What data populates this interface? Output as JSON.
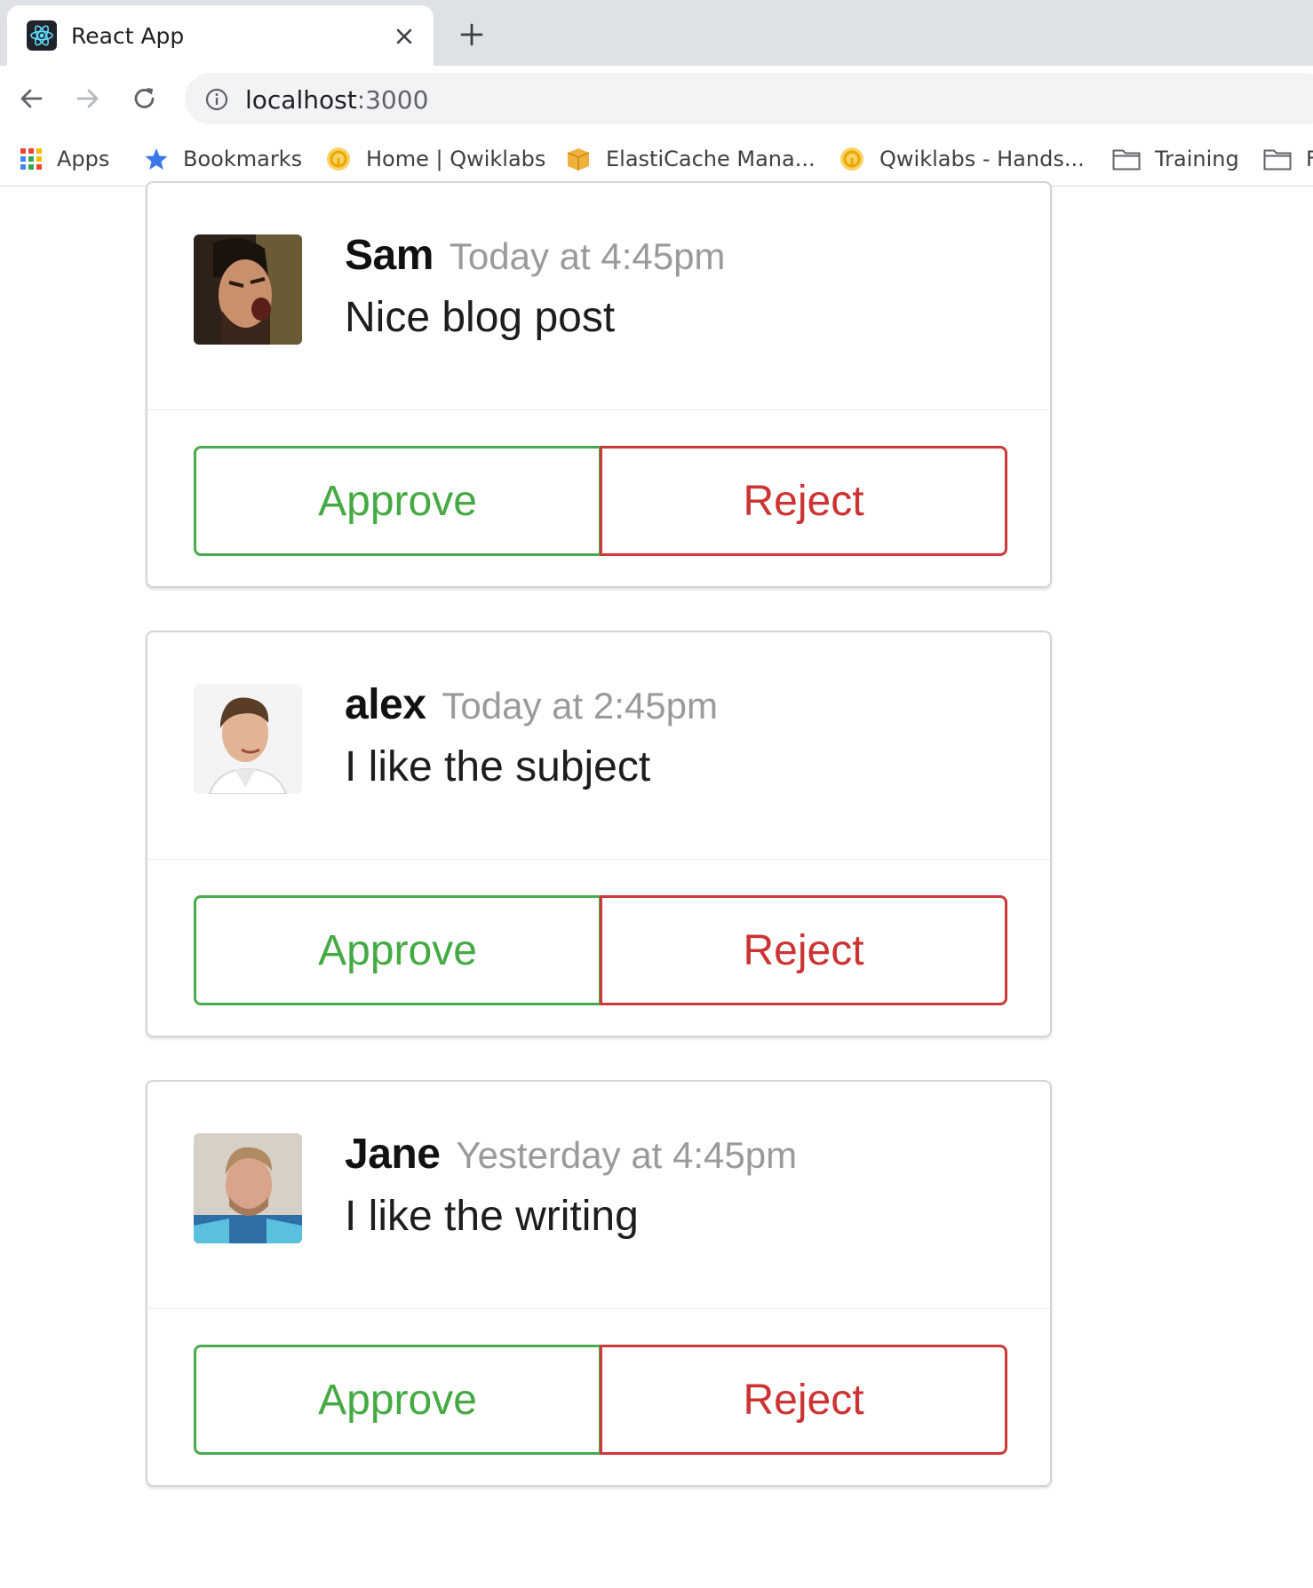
{
  "browser": {
    "tab_title": "React App",
    "url_host": "localhost",
    "url_port": ":3000",
    "bookmarks": [
      {
        "label": "Apps",
        "icon": "apps-grid-icon"
      },
      {
        "label": "Bookmarks",
        "icon": "star-icon"
      },
      {
        "label": "Home | Qwiklabs",
        "icon": "qwiklabs-icon"
      },
      {
        "label": "ElastiCache Mana...",
        "icon": "aws-box-icon"
      },
      {
        "label": "Qwiklabs - Hands...",
        "icon": "qwiklabs-icon"
      },
      {
        "label": "Training",
        "icon": "folder-icon"
      },
      {
        "label": "F",
        "icon": "folder-icon"
      }
    ]
  },
  "cards": [
    {
      "author": "Sam",
      "time": "Today at 4:45pm",
      "text": "Nice blog post",
      "approve": "Approve",
      "reject": "Reject"
    },
    {
      "author": "alex",
      "time": "Today at 2:45pm",
      "text": "I like the subject",
      "approve": "Approve",
      "reject": "Reject"
    },
    {
      "author": "Jane",
      "time": "Yesterday at 4:45pm",
      "text": "I like the writing",
      "approve": "Approve",
      "reject": "Reject"
    }
  ],
  "colors": {
    "approve": "#45a944",
    "reject": "#cc3333",
    "meta_text": "#9a9a9a"
  }
}
